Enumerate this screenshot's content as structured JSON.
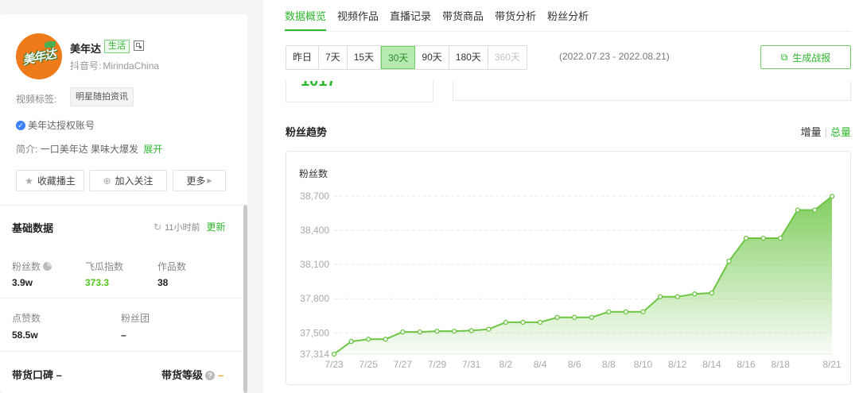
{
  "profile": {
    "avatar_text": "美年达",
    "name": "美年达",
    "tag": "生活",
    "id_label": "抖音号:",
    "id_value": "MirindaChina",
    "video_tags_label": "视频标签:",
    "video_tag": "明星随拍资讯",
    "auth_text": "美年达授权账号",
    "intro_label": "简介:",
    "intro_text": "一口美年达 果味大爆发",
    "intro_more": "展开",
    "buttons": {
      "collect": "收藏播主",
      "follow": "加入关注",
      "more": "更多"
    }
  },
  "basic": {
    "title": "基础数据",
    "updated": "11小时前",
    "update_label": "更新",
    "stats": [
      {
        "label": "粉丝数",
        "value": "3.9w"
      },
      {
        "label": "飞瓜指数",
        "value": "373.3"
      },
      {
        "label": "作品数",
        "value": "38"
      },
      {
        "label": "点赞数",
        "value": "58.5w"
      },
      {
        "label": "粉丝团",
        "value": "–"
      }
    ],
    "reputation_label": "带货口碑 –",
    "level_label": "带货等级",
    "level_value": "–"
  },
  "tabs": [
    "数据概览",
    "视频作品",
    "直播记录",
    "带货商品",
    "带货分析",
    "粉丝分析"
  ],
  "ranges": [
    "昨日",
    "7天",
    "15天",
    "30天",
    "90天",
    "180天",
    "360天"
  ],
  "date_range": "(2022.07.23 - 2022.08.21)",
  "report_label": "生成战报",
  "card_number": "1017",
  "trend_title": "粉丝趋势",
  "toggle": {
    "increment": "增量",
    "total": "总量"
  },
  "colors": {
    "accent": "#2eb82e",
    "line": "#6cc644"
  },
  "chart_data": {
    "type": "area",
    "title": "粉丝数",
    "x": [
      "7/23",
      "7/24",
      "7/25",
      "7/26",
      "7/27",
      "7/28",
      "7/29",
      "7/30",
      "7/31",
      "8/1",
      "8/2",
      "8/3",
      "8/4",
      "8/5",
      "8/6",
      "8/7",
      "8/8",
      "8/9",
      "8/10",
      "8/11",
      "8/12",
      "8/13",
      "8/14",
      "8/15",
      "8/16",
      "8/17",
      "8/18",
      "8/19",
      "8/20",
      "8/21"
    ],
    "x_tick_labels": [
      "7/23",
      "7/25",
      "7/27",
      "7/29",
      "7/31",
      "8/2",
      "8/4",
      "8/6",
      "8/8",
      "8/10",
      "8/12",
      "8/14",
      "8/16",
      "8/18",
      "8/21"
    ],
    "values": [
      37314,
      37425,
      37445,
      37445,
      37508,
      37508,
      37515,
      37515,
      37520,
      37532,
      37593,
      37593,
      37593,
      37636,
      37636,
      37636,
      37685,
      37685,
      37685,
      37817,
      37817,
      37842,
      37850,
      38129,
      38331,
      38331,
      38331,
      38578,
      38578,
      38698
    ],
    "y_ticks": [
      37314,
      37500,
      37800,
      38100,
      38400,
      38700
    ],
    "ylim": [
      37314,
      38700
    ],
    "grid": true,
    "legend": "none"
  }
}
